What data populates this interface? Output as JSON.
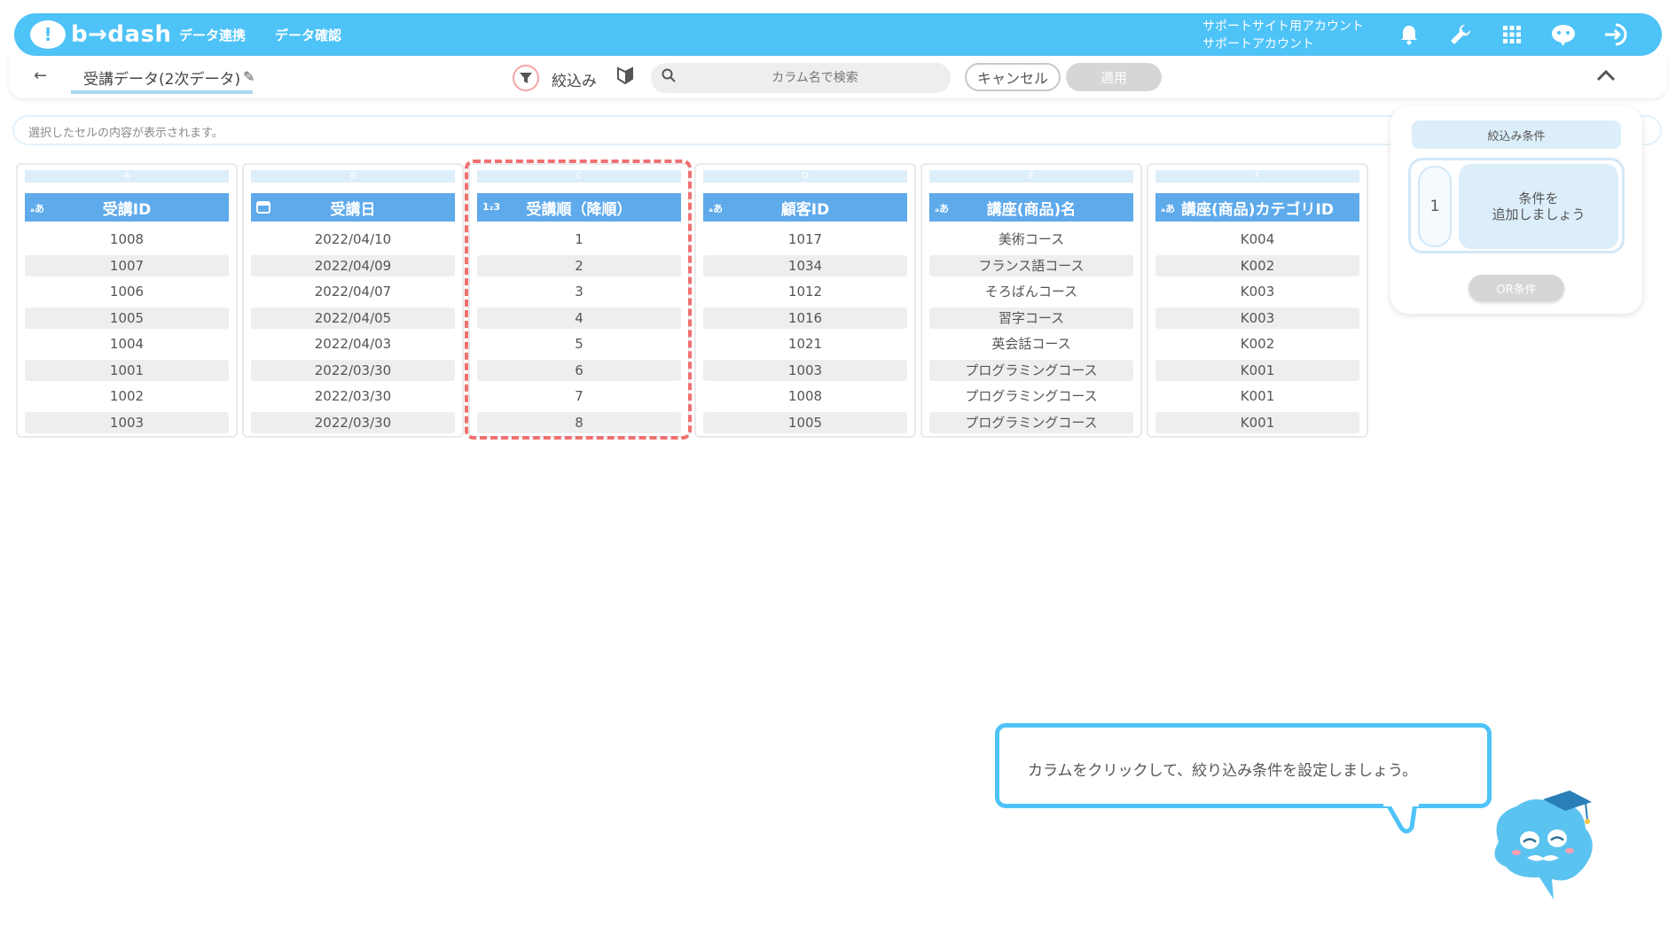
{
  "app": {
    "logo_text": "b→dash",
    "nav": [
      "データ連携",
      "データ確認"
    ],
    "account": {
      "line1": "サポートサイト用アカウント",
      "line2": "サポートアカウント"
    },
    "icons": [
      "bell-icon",
      "wrench-icon",
      "grid-icon",
      "mascot-icon",
      "logout-icon"
    ]
  },
  "toolbar": {
    "title": "受講データ(2次データ)",
    "filter_label": "絞込み",
    "search_placeholder": "カラム名で検索",
    "cancel_label": "キャンセル",
    "apply_label": "適用"
  },
  "cell_bar": {
    "placeholder": "選択したセルの内容が表示されます。"
  },
  "columns": [
    {
      "letter": "A",
      "type_icon": "ₐあ",
      "header": "受講ID",
      "rows": [
        "1008",
        "1007",
        "1006",
        "1005",
        "1004",
        "1001",
        "1002",
        "1003"
      ]
    },
    {
      "letter": "B",
      "type_icon": "calendar",
      "header": "受講日",
      "rows": [
        "2022/04/10",
        "2022/04/09",
        "2022/04/07",
        "2022/04/05",
        "2022/04/03",
        "2022/03/30",
        "2022/03/30",
        "2022/03/30"
      ]
    },
    {
      "letter": "C",
      "type_icon": "1₂3",
      "header": "受講順（降順）",
      "rows": [
        "1",
        "2",
        "3",
        "4",
        "5",
        "6",
        "7",
        "8"
      ]
    },
    {
      "letter": "D",
      "type_icon": "ₐあ",
      "header": "顧客ID",
      "rows": [
        "1017",
        "1034",
        "1012",
        "1016",
        "1021",
        "1003",
        "1008",
        "1005"
      ]
    },
    {
      "letter": "E",
      "type_icon": "ₐあ",
      "header": "講座(商品)名",
      "rows": [
        "美術コース",
        "フランス語コース",
        "そろばんコース",
        "習字コース",
        "英会話コース",
        "プログラミングコース",
        "プログラミングコース",
        "プログラミングコース"
      ]
    },
    {
      "letter": "F",
      "type_icon": "ₐあ",
      "header": "講座(商品)カテゴリID",
      "rows": [
        "K004",
        "K002",
        "K003",
        "K003",
        "K002",
        "K001",
        "K001",
        "K001"
      ]
    }
  ],
  "filter_panel": {
    "title": "絞込み条件",
    "condition_number": "1",
    "add_condition_line1": "条件を",
    "add_condition_line2": "追加しましょう",
    "or_label": "OR条件"
  },
  "hint": {
    "text": "カラムをクリックして、絞り込み条件を設定しましょう。"
  },
  "colors": {
    "brand": "#4ec3f7",
    "column_header": "#5eaaeb",
    "highlight": "#f07070"
  }
}
